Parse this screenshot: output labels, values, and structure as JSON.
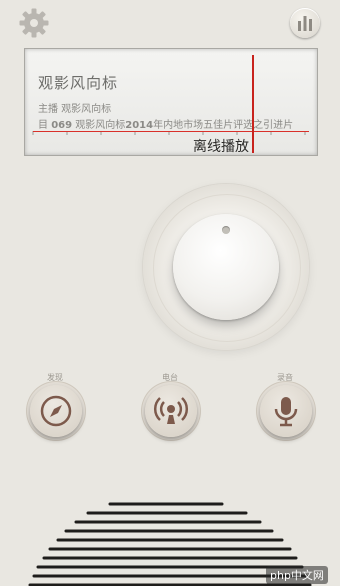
{
  "header": {
    "settings_icon": "gear-icon",
    "equalizer_icon": "bar-chart-icon"
  },
  "screen": {
    "program_title": "观影风向标",
    "host_line": "主播 观影风向标",
    "ticker": {
      "part1": "目 ",
      "num1": "069",
      "part2": " 观影风向标",
      "num2": "2014",
      "part3": "年内地市场五佳片评选之引进片"
    },
    "needle_color": "#c8231d",
    "offline_label": "离线播放"
  },
  "controls": {
    "knob": "tuning-knob",
    "buttons": [
      {
        "label": "发现",
        "icon": "compass-icon"
      },
      {
        "label": "电台",
        "icon": "radio-broadcast-icon"
      },
      {
        "label": "录音",
        "icon": "microphone-icon"
      }
    ]
  },
  "watermark": "php中文网"
}
